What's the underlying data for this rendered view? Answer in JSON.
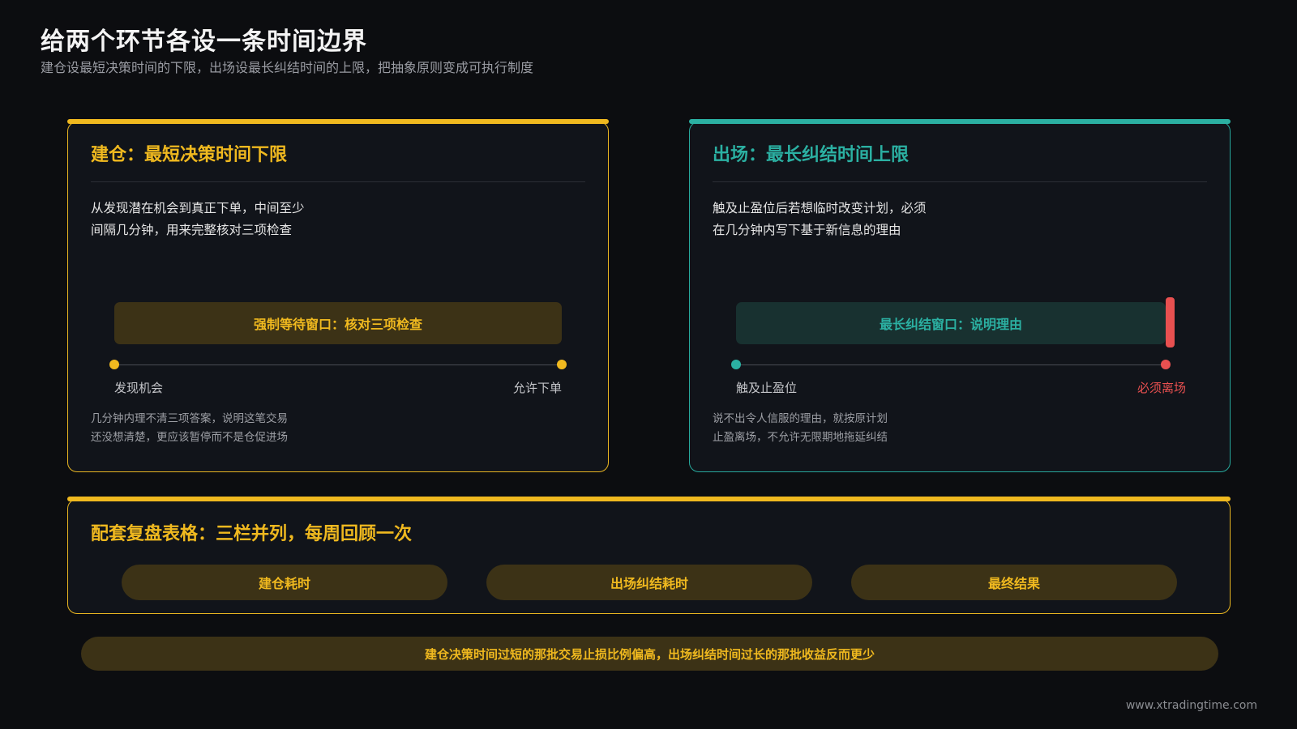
{
  "header": {
    "title": "给两个环节各设一条时间边界",
    "subtitle": "建仓设最短决策时间的下限，出场设最长纠结时间的上限，把抽象原则变成可执行制度"
  },
  "entry_card": {
    "title": "建仓：最短决策时间下限",
    "body_line1": "从发现潜在机会到真正下单，中间至少",
    "body_line2": "间隔几分钟，用来完整核对三项检查",
    "window_label": "强制等待窗口：核对三项检查",
    "start_label": "发现机会",
    "end_label": "允许下单",
    "note_line1": "几分钟内理不清三项答案，说明这笔交易",
    "note_line2": "还没想清楚，更应该暂停而不是仓促进场",
    "accent_color": "#f0b91f"
  },
  "exit_card": {
    "title": "出场：最长纠结时间上限",
    "body_line1": "触及止盈位后若想临时改变计划，必须",
    "body_line2": "在几分钟内写下基于新信息的理由",
    "window_label": "最长纠结窗口：说明理由",
    "start_label": "触及止盈位",
    "end_label": "必须离场",
    "note_line1": "说不出令人信服的理由，就按原计划",
    "note_line2": "止盈离场，不允许无限期地拖延纠结",
    "accent_color": "#2bb0a2",
    "deadline_color": "#e85050"
  },
  "review": {
    "title": "配套复盘表格：三栏并列，每周回顾一次",
    "columns": [
      "建仓耗时",
      "出场纠结耗时",
      "最终结果"
    ]
  },
  "footer": {
    "conclusion": "建仓决策时间过短的那批交易止损比例偏高，出场纠结时间过长的那批收益反而更少"
  },
  "watermark": "www.xtradingtime.com"
}
